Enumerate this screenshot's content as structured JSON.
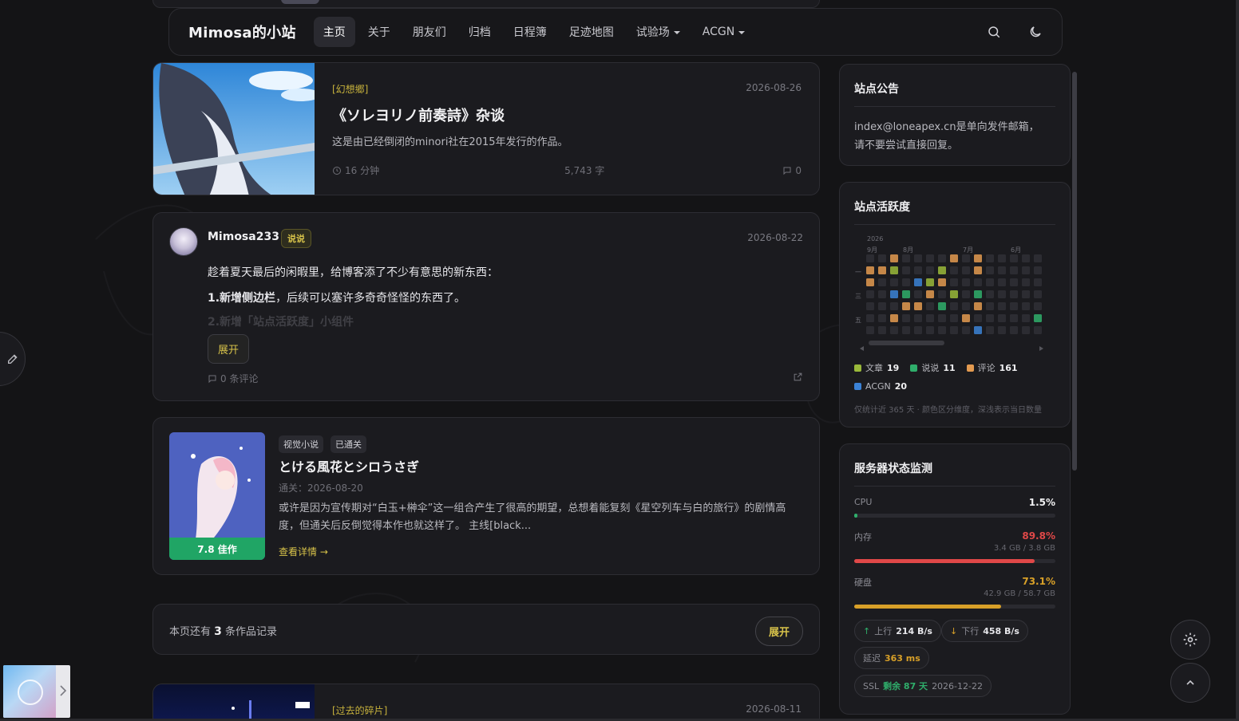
{
  "nav": {
    "brand": "Mimosa的小站",
    "items": [
      {
        "label": "主页",
        "active": true
      },
      {
        "label": "关于"
      },
      {
        "label": "朋友们"
      },
      {
        "label": "归档"
      },
      {
        "label": "日程簿"
      },
      {
        "label": "足迹地图"
      },
      {
        "label": "试验场",
        "dropdown": true
      },
      {
        "label": "ACGN",
        "dropdown": true
      }
    ],
    "icons": [
      "search-icon",
      "moon-icon"
    ]
  },
  "post1": {
    "tag": "[幻想郷]",
    "date": "2026-08-26",
    "title": "《ソレヨリノ前奏詩》杂谈",
    "excerpt": "这是由已经倒闭的minori社在2015年发行的作品。",
    "read_time": "16 分钟",
    "words": "5,743 字",
    "comments": "0"
  },
  "moment": {
    "user": "Mimosa233",
    "badge": "说说",
    "date": "2026-08-22",
    "line1": "趁着夏天最后的闲暇里，给博客添了不少有意思的新东西：",
    "line2_bold": "1.新增侧边栏",
    "line2_rest": "，后续可以塞许多奇奇怪怪的东西了。",
    "line3": "2.新增「站点活跃度」小组件",
    "expand": "展开",
    "comments": "0 条评论"
  },
  "vn": {
    "tags": [
      "视觉小说",
      "已通关"
    ],
    "title": "とける風花とシロうさぎ",
    "cleared": "通关：2026-08-20",
    "desc": "或许是因为宣传期对“白玉+榊伞”这一组合产生了很高的期望，总想着能复刻《星空列车与白的旅行》的剧情高度，但通关后反倒觉得本作也就这样了。 主线[black...",
    "more": "查看详情 →",
    "score": "7.8 佳作"
  },
  "remain": {
    "prefix": "本页还有",
    "count": "3",
    "suffix": "条作品记录",
    "button": "展开"
  },
  "post4": {
    "tag": "[过去的碎片]",
    "date": "2026-08-11"
  },
  "notice": {
    "title": "站点公告",
    "line1": "index@loneapex.cn是单向发件邮箱，",
    "line2": "请不要尝试直接回复。"
  },
  "activity": {
    "title": "站点活跃度",
    "year": "2026",
    "months": [
      "9月",
      "8月",
      "7月",
      "6月"
    ],
    "days": [
      "一",
      "三",
      "五"
    ],
    "legend": [
      {
        "name": "文章",
        "count": "19",
        "color": "#9ab93a"
      },
      {
        "name": "说说",
        "count": "11",
        "color": "#2fae6b"
      },
      {
        "name": "评论",
        "count": "161",
        "color": "#e39a50"
      },
      {
        "name": "ACGN",
        "count": "20",
        "color": "#3b82d6"
      }
    ],
    "note": "仅统计近 365 天 · 颜色区分维度，深浅表示当日数量"
  },
  "server": {
    "title": "服务器状态监测",
    "cpu": {
      "label": "CPU",
      "value": "1.5%",
      "fraction": 0.015,
      "color": "#2fae6b"
    },
    "mem": {
      "label": "内存",
      "value": "89.8%",
      "sub": "3.4 GB / 3.8 GB",
      "fraction": 0.898,
      "color": "#e04848"
    },
    "disk": {
      "label": "硬盘",
      "value": "73.1%",
      "sub": "42.9 GB / 58.7 GB",
      "fraction": 0.731,
      "color": "#d8a028"
    },
    "up_label": "上行",
    "up": "214 B/s",
    "down_label": "下行",
    "down": "458 B/s",
    "latency_label": "延迟",
    "latency": "363 ms",
    "ssl_label": "SSL",
    "ssl_remain": "剩余 87 天",
    "ssl_date": "2026-12-22"
  }
}
